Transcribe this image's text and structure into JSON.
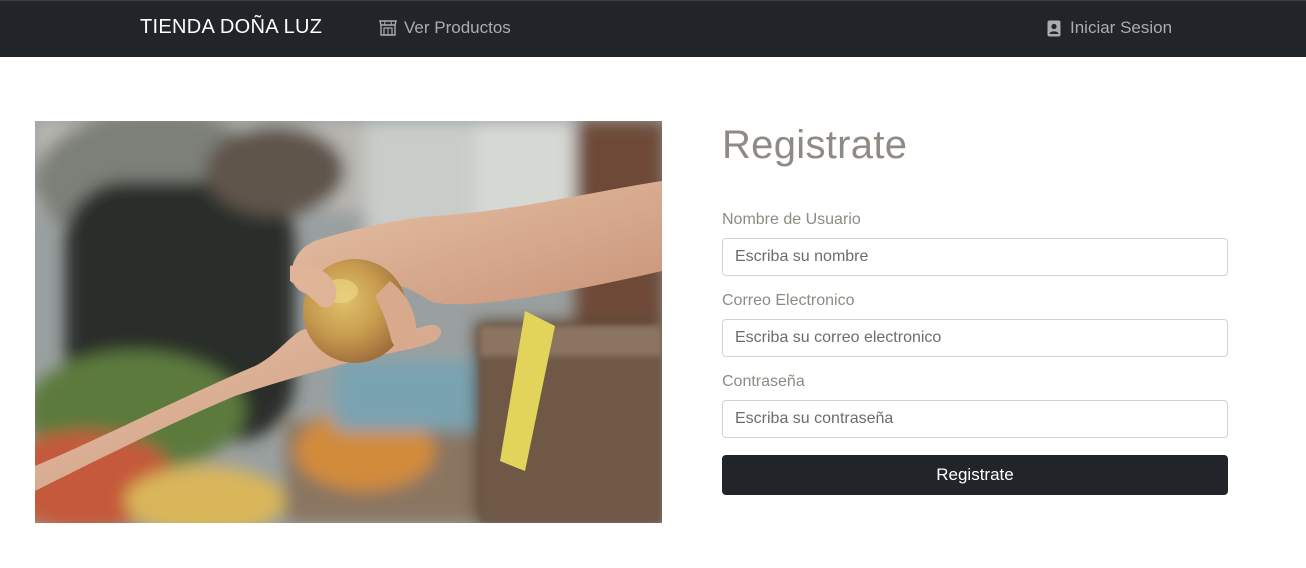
{
  "navbar": {
    "brand": "TIENDA DOÑA LUZ",
    "products_link": {
      "label": "Ver Productos",
      "icon": "store-icon"
    },
    "login_link": {
      "label": "Iniciar Sesion",
      "icon": "contact-card-icon"
    }
  },
  "hero_image": {
    "description_icon": "photo"
  },
  "form": {
    "title": "Registrate",
    "fields": [
      {
        "label": "Nombre de Usuario",
        "placeholder": "Escriba su nombre"
      },
      {
        "label": "Correo Electronico",
        "placeholder": "Escriba su correo electronico"
      },
      {
        "label": "Contraseña",
        "placeholder": "Escriba su contraseña"
      }
    ],
    "submit_label": "Registrate"
  },
  "colors": {
    "navbar_bg": "#212529",
    "muted_text": "#8f8a83",
    "button_bg": "#212529"
  }
}
